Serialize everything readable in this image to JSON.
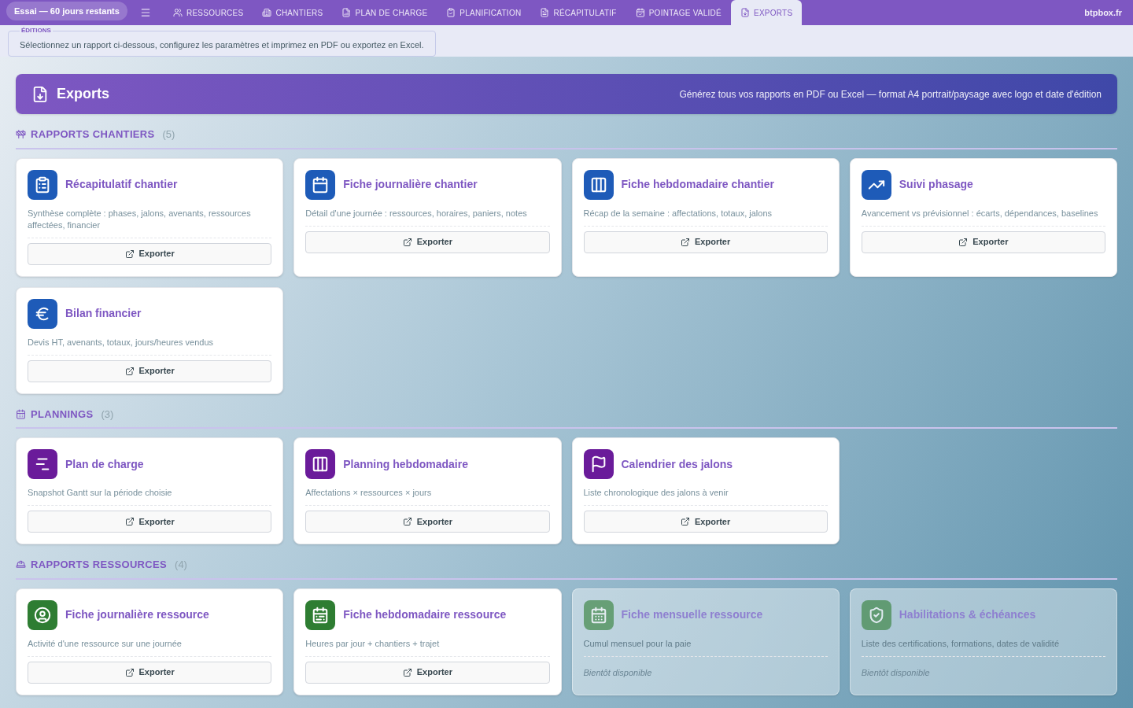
{
  "trial_badge": "Essai — 60 jours restants",
  "tabs": [
    {
      "label": "RESSOURCES",
      "selected": false
    },
    {
      "label": "CHANTIERS",
      "selected": false
    },
    {
      "label": "PLAN DE CHARGE",
      "selected": false
    },
    {
      "label": "PLANIFICATION",
      "selected": false
    },
    {
      "label": "RÉCAPITULATIF",
      "selected": false
    },
    {
      "label": "POINTAGE VALIDÉ",
      "selected": false
    },
    {
      "label": "EXPORTS",
      "selected": true
    }
  ],
  "site": "btpbox.fr",
  "editions": {
    "legend": "ÉDITIONS",
    "text": "Sélectionnez un rapport ci-dessous, configurez les paramètres et imprimez en PDF ou exportez en Excel."
  },
  "banner": {
    "title": "Exports",
    "subtitle": "Générez tous vos rapports en PDF ou Excel — format A4 portrait/paysage avec logo et date d'édition"
  },
  "sections": [
    {
      "title": "RAPPORTS CHANTIERS",
      "count": "(5)",
      "color": "#1e5bb8",
      "cards": [
        {
          "title": "Récapitulatif chantier",
          "description": "Synthèse complète : phases, jalons, avenants, ressources affectées, financier",
          "disabled": false,
          "action": "Exporter"
        },
        {
          "title": "Fiche journalière chantier",
          "description": "Détail d'une journée : ressources, horaires, paniers, notes",
          "disabled": false,
          "action": "Exporter"
        },
        {
          "title": "Fiche hebdomadaire chantier",
          "description": "Récap de la semaine : affectations, totaux, jalons",
          "disabled": false,
          "action": "Exporter"
        },
        {
          "title": "Suivi phasage",
          "description": "Avancement vs prévisionnel : écarts, dépendances, baselines",
          "disabled": false,
          "action": "Exporter"
        },
        {
          "title": "Bilan financier",
          "description": "Devis HT, avenants, totaux, jours/heures vendus",
          "disabled": false,
          "action": "Exporter"
        }
      ]
    },
    {
      "title": "PLANNINGS",
      "count": "(3)",
      "color": "#6a1b9a",
      "cards": [
        {
          "title": "Plan de charge",
          "description": "Snapshot Gantt sur la période choisie",
          "disabled": false,
          "action": "Exporter"
        },
        {
          "title": "Planning hebdomadaire",
          "description": "Affectations × ressources × jours",
          "disabled": false,
          "action": "Exporter"
        },
        {
          "title": "Calendrier des jalons",
          "description": "Liste chronologique des jalons à venir",
          "disabled": false,
          "action": "Exporter"
        }
      ]
    },
    {
      "title": "RAPPORTS RESSOURCES",
      "count": "(4)",
      "color": "#2e7d32",
      "cards": [
        {
          "title": "Fiche journalière ressource",
          "description": "Activité d'une ressource sur une journée",
          "disabled": false,
          "action": "Exporter"
        },
        {
          "title": "Fiche hebdomadaire ressource",
          "description": "Heures par jour + chantiers + trajet",
          "disabled": false,
          "action": "Exporter"
        },
        {
          "title": "Fiche mensuelle ressource",
          "description": "Cumul mensuel pour la paie",
          "disabled": true,
          "action": "Bientôt disponible"
        },
        {
          "title": "Habilitations & échéances",
          "description": "Liste des certifications, formations, dates de validité",
          "disabled": true,
          "action": "Bientôt disponible"
        }
      ]
    }
  ]
}
